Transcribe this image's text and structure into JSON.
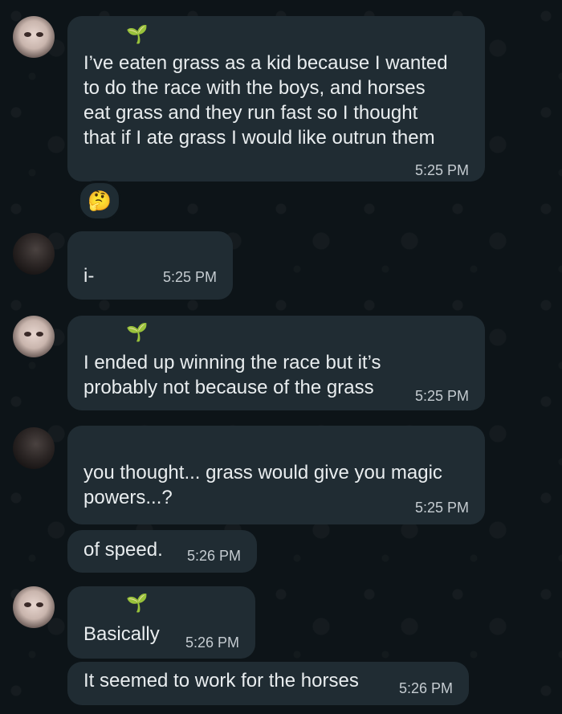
{
  "messages": [
    {
      "text": "I’ve eaten grass as a kid because I wanted\nto do the race with the boys, and horses\neat grass and they run fast so I thought\nthat if I ate grass I would like outrun them",
      "time": "5:25 PM",
      "status_emoji": "🌱",
      "reaction": "🤔"
    },
    {
      "text": "i-",
      "time": "5:25 PM"
    },
    {
      "text": "I ended up winning the race but it’s\nprobably not because of the grass",
      "time": "5:25 PM",
      "status_emoji": "🌱"
    },
    {
      "text": "you thought... grass would give you magic\npowers...?",
      "time": "5:25 PM"
    },
    {
      "text": "of speed.",
      "time": "5:26 PM"
    },
    {
      "text": "Basically",
      "time": "5:26 PM",
      "status_emoji": "🌱"
    },
    {
      "text": "It seemed to work for the horses",
      "time": "5:26 PM"
    }
  ],
  "colors": {
    "bubble": "#202c33",
    "text": "#e9edef",
    "timestamp": "#c5ccd1",
    "wallpaper": "#0d1418"
  }
}
